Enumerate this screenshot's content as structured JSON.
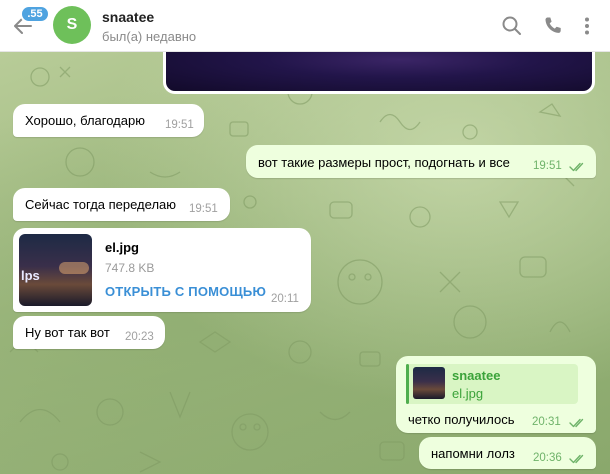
{
  "header": {
    "unread_count": ".55",
    "avatar_letter": "S",
    "chat_name": "snaatee",
    "status": "был(а) недавно",
    "icons": [
      "back-arrow-icon",
      "search-icon",
      "phone-icon",
      "more-vertical-icon"
    ]
  },
  "messages": [
    {
      "direction": "in",
      "text": "Хорошо, благодарю",
      "time": "19:51"
    },
    {
      "direction": "out",
      "text": "вот такие размеры прост, подогнать и все",
      "time": "19:51",
      "read": true
    },
    {
      "direction": "in",
      "text": "Сейчас тогда переделаю",
      "time": "19:51"
    },
    {
      "direction": "in",
      "type": "file",
      "file_name": "el.jpg",
      "file_size": "747.8 KB",
      "action": "ОТКРЫТЬ С ПОМОЩЬЮ",
      "thumb_text": "lps",
      "time": "20:11"
    },
    {
      "direction": "in",
      "text": "Ну вот так вот",
      "time": "20:23"
    },
    {
      "direction": "out",
      "reply_author": "snaatee",
      "reply_file": "el.jpg",
      "text": "четко получилось",
      "time": "20:31",
      "read": true
    },
    {
      "direction": "out",
      "text": "напомни лолз",
      "time": "20:36",
      "read": true
    }
  ],
  "colors": {
    "accent": "#4fa3e0",
    "avatar": "#6ec05a",
    "outgoing_bubble": "#eeffde",
    "reply_accent": "#3ba33a",
    "link": "#3a8fd6"
  }
}
